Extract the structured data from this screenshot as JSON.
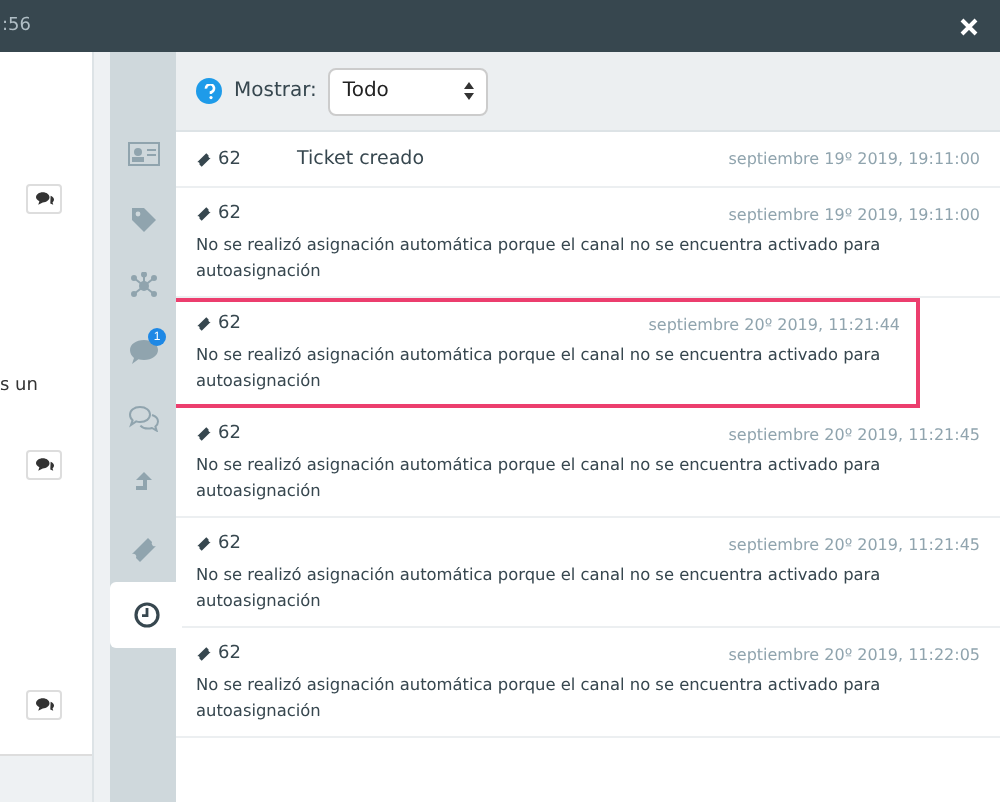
{
  "top_bar": {
    "time": ":56"
  },
  "left_panel": {
    "snippet": "s un"
  },
  "sidebar": {
    "items": [
      {
        "selected": false
      },
      {
        "selected": false
      },
      {
        "selected": false
      },
      {
        "selected": false,
        "badge": "1"
      },
      {
        "selected": false
      },
      {
        "selected": false
      },
      {
        "selected": false
      },
      {
        "selected": true
      }
    ]
  },
  "filter": {
    "label": "Mostrar:",
    "value": "Todo"
  },
  "entries": [
    {
      "ticket": "62",
      "text": "Ticket creado",
      "date": "septiembre 19º 2019, 19:11:00",
      "kind": "inline",
      "highlighted": false
    },
    {
      "ticket": "62",
      "text": "No se realizó asignación automática porque el canal no se encuentra activado para autoasignación",
      "date": "septiembre 19º 2019, 19:11:00",
      "kind": "block",
      "highlighted": false
    },
    {
      "ticket": "62",
      "text": "No se realizó asignación automática porque el canal no se encuentra activado para autoasignación",
      "date": "septiembre 20º 2019, 11:21:44",
      "kind": "block",
      "highlighted": true
    },
    {
      "ticket": "62",
      "text": "No se realizó asignación automática porque el canal no se encuentra activado para autoasignación",
      "date": "septiembre 20º 2019, 11:21:45",
      "kind": "block",
      "highlighted": false
    },
    {
      "ticket": "62",
      "text": "No se realizó asignación automática porque el canal no se encuentra activado para autoasignación",
      "date": "septiembre 20º 2019, 11:21:45",
      "kind": "block",
      "highlighted": false
    },
    {
      "ticket": "62",
      "text": "No se realizó asignación automática porque el canal no se encuentra activado para autoasignación",
      "date": "septiembre 20º 2019, 11:22:05",
      "kind": "block",
      "highlighted": false
    }
  ]
}
